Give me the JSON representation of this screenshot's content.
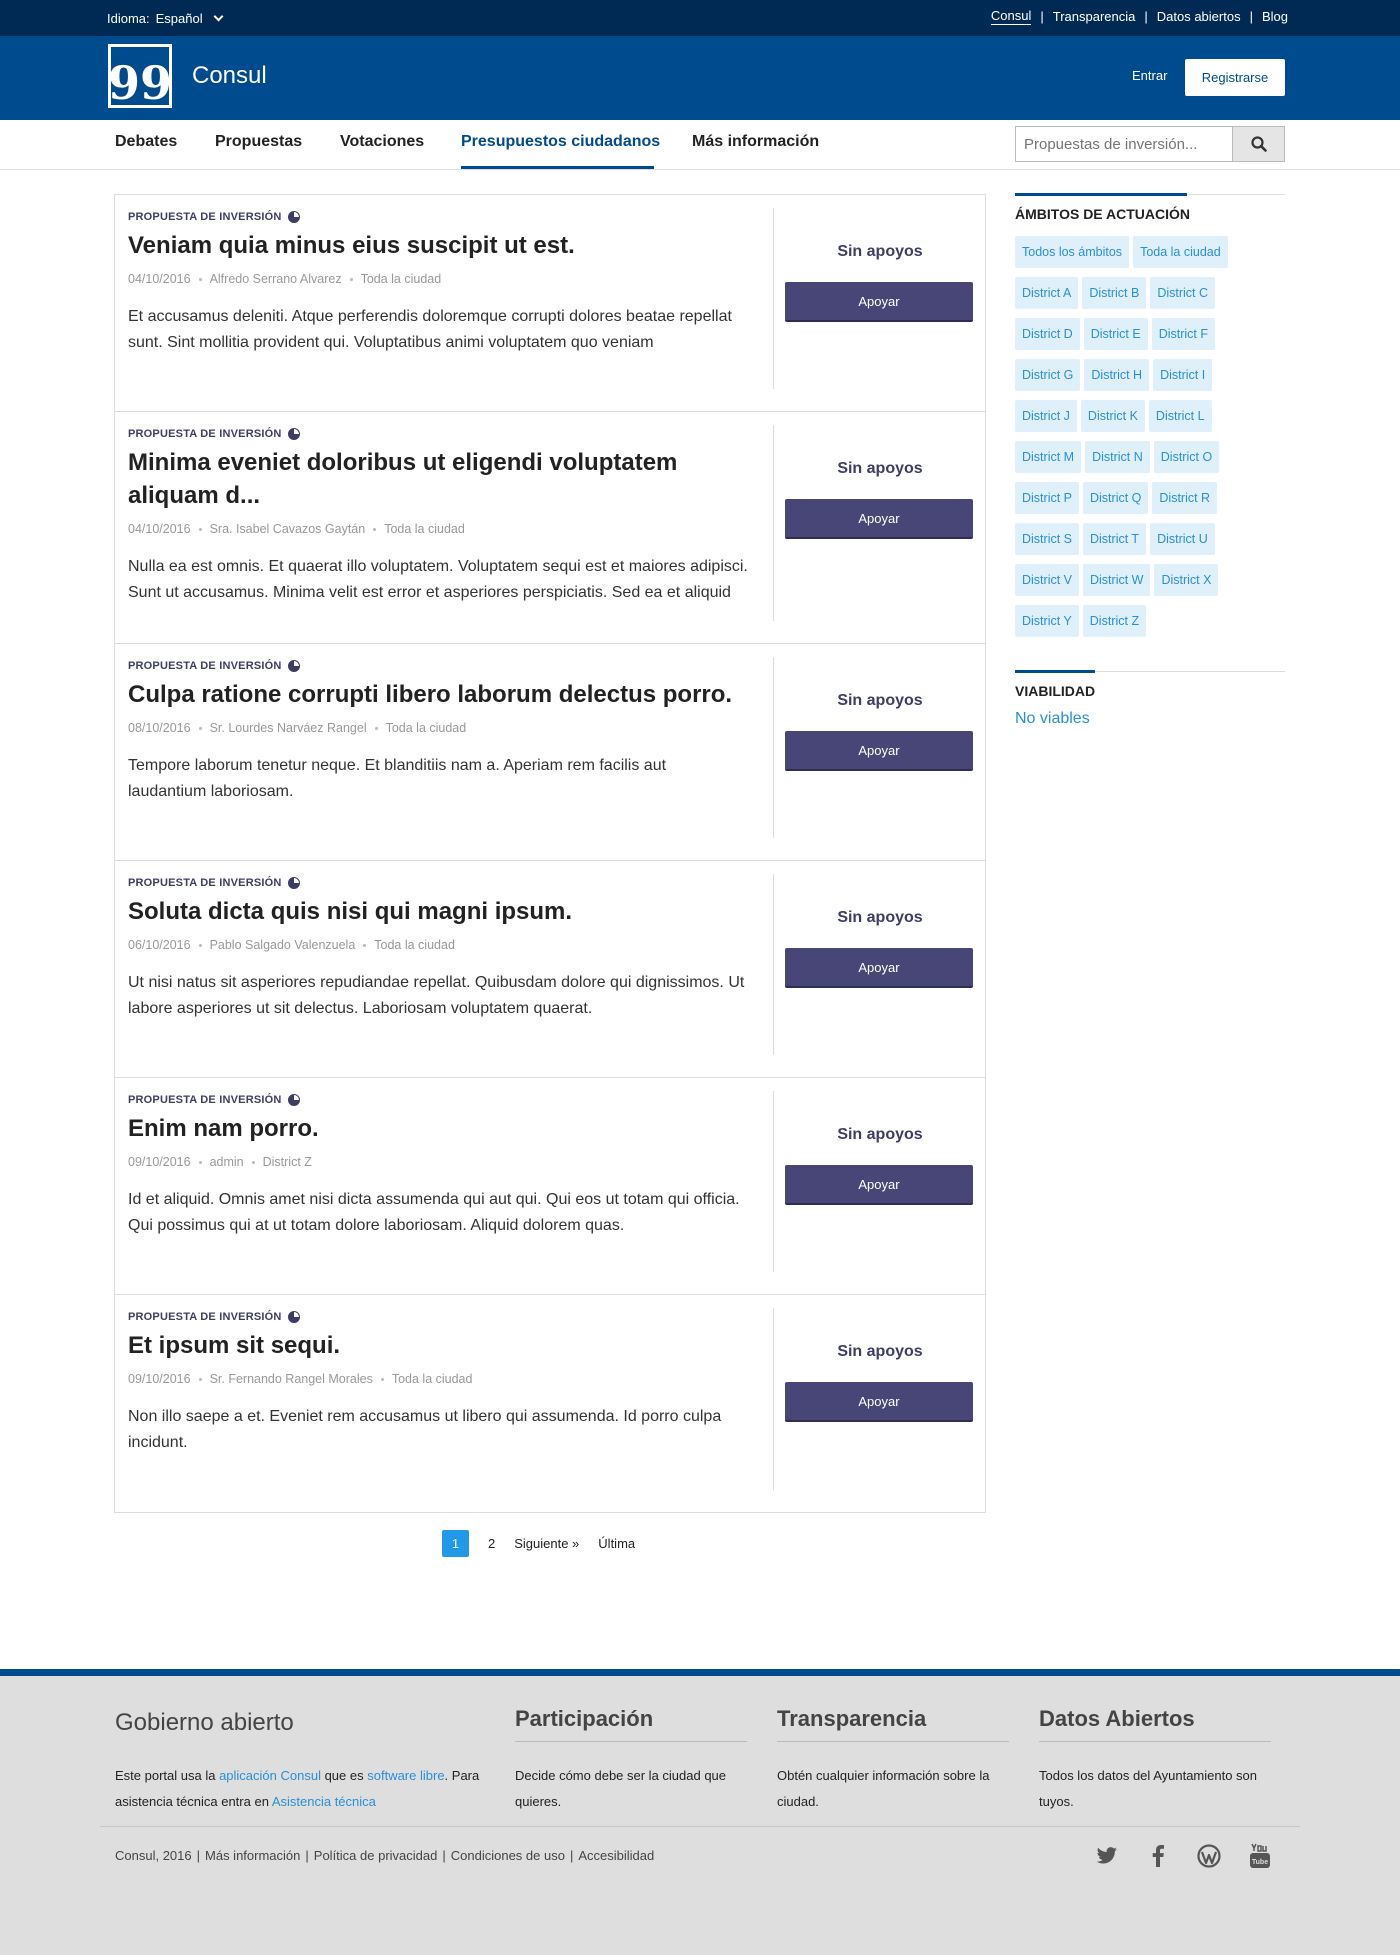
{
  "topbar": {
    "lang_label": "Idioma:",
    "lang_value": "Español",
    "links": [
      "Consul",
      "Transparencia",
      "Datos abiertos",
      "Blog"
    ]
  },
  "header": {
    "logo_glyph": "99",
    "site_name": "Consul",
    "login": "Entrar",
    "register": "Registrarse"
  },
  "nav": {
    "items": [
      "Debates",
      "Propuestas",
      "Votaciones",
      "Presupuestos ciudadanos",
      "Más información"
    ],
    "active": "Presupuestos ciudadanos"
  },
  "search": {
    "placeholder": "Propuestas de inversión..."
  },
  "proposals": [
    {
      "tag": "Propuesta de inversión",
      "title": "Veniam quia minus eius suscipit ut est.",
      "date": "04/10/2016",
      "author": "Alfredo Serrano Alvarez",
      "scope": "Toda la ciudad",
      "description": "Et accusamus deleniti. Atque perferendis doloremque corrupti dolores beatae repellat sunt. Sint mollitia provident qui. Voluptatibus animi voluptatem quo veniam",
      "supports": "Sin apoyos",
      "button": "Apoyar"
    },
    {
      "tag": "Propuesta de inversión",
      "title": "Minima eveniet doloribus ut eligendi voluptatem aliquam d...",
      "date": "04/10/2016",
      "author": "Sra. Isabel Cavazos Gaytán",
      "scope": "Toda la ciudad",
      "description": "Nulla ea est omnis. Et quaerat illo voluptatem. Voluptatem sequi est et maiores adipisci. Sunt ut accusamus. Minima velit est error et asperiores perspiciatis. Sed ea et aliquid",
      "supports": "Sin apoyos",
      "button": "Apoyar"
    },
    {
      "tag": "Propuesta de inversión",
      "title": "Culpa ratione corrupti libero laborum delectus porro.",
      "date": "08/10/2016",
      "author": "Sr. Lourdes Narváez Rangel",
      "scope": "Toda la ciudad",
      "description": "Tempore laborum tenetur neque. Et blanditiis nam a. Aperiam rem facilis aut laudantium laboriosam.",
      "supports": "Sin apoyos",
      "button": "Apoyar"
    },
    {
      "tag": "Propuesta de inversión",
      "title": "Soluta dicta quis nisi qui magni ipsum.",
      "date": "06/10/2016",
      "author": "Pablo Salgado Valenzuela",
      "scope": "Toda la ciudad",
      "description": "Ut nisi natus sit asperiores repudiandae repellat. Quibusdam dolore qui dignissimos. Ut labore asperiores ut sit delectus. Laboriosam voluptatem quaerat.",
      "supports": "Sin apoyos",
      "button": "Apoyar"
    },
    {
      "tag": "Propuesta de inversión",
      "title": "Enim nam porro.",
      "date": "09/10/2016",
      "author": "admin",
      "scope": "District Z",
      "description": "Id et aliquid. Omnis amet nisi dicta assumenda qui aut qui. Qui eos ut totam qui officia. Qui possimus qui at ut totam dolore laboriosam. Aliquid dolorem quas.",
      "supports": "Sin apoyos",
      "button": "Apoyar"
    },
    {
      "tag": "Propuesta de inversión",
      "title": "Et ipsum sit sequi.",
      "date": "09/10/2016",
      "author": "Sr. Fernando Rangel Morales",
      "scope": "Toda la ciudad",
      "description": "Non illo saepe a et. Eveniet rem accusamus ut libero qui assumenda. Id porro culpa incidunt.",
      "supports": "Sin apoyos",
      "button": "Apoyar"
    }
  ],
  "pagination": {
    "current": "1",
    "next_page": "2",
    "next": "Siguiente »",
    "last": "Última"
  },
  "sidebar": {
    "scopes_title": "Ámbitos de actuación",
    "scopes": [
      "Todos los ámbitos",
      "Toda la ciudad",
      "District A",
      "District B",
      "District C",
      "District D",
      "District E",
      "District F",
      "District G",
      "District H",
      "District I",
      "District J",
      "District K",
      "District L",
      "District M",
      "District N",
      "District O",
      "District P",
      "District Q",
      "District R",
      "District S",
      "District T",
      "District U",
      "District V",
      "District W",
      "District X",
      "District Y",
      "District Z"
    ],
    "viability_title": "Viabilidad",
    "viability_link": "No viables"
  },
  "footer": {
    "title": "Gobierno abierto",
    "intro_1": "Este portal usa la ",
    "intro_link1": "aplicación Consul",
    "intro_2": " que es ",
    "intro_link2": "software libre",
    "intro_3": ". Para asistencia técnica entra en ",
    "intro_link3": "Asistencia técnica",
    "columns": [
      {
        "title": "Participación",
        "text": "Decide cómo debe ser la ciudad que quieres."
      },
      {
        "title": "Transparencia",
        "text": "Obtén cualquier información sobre la ciudad."
      },
      {
        "title": "Datos Abiertos",
        "text": "Todos los datos del Ayuntamiento son tuyos."
      }
    ],
    "bottom_links": [
      "Consul, 2016",
      "Más información",
      "Política de privacidad",
      "Condiciones de uso",
      "Accesibilidad"
    ],
    "socials": [
      "twitter-icon",
      "facebook-icon",
      "wordpress-icon",
      "youtube-icon"
    ]
  },
  "colors": {
    "brand": "#004a8e",
    "topbar": "#002a54",
    "button": "#474677",
    "tag_bg": "#dff0fb",
    "link": "#2a8fd6"
  }
}
